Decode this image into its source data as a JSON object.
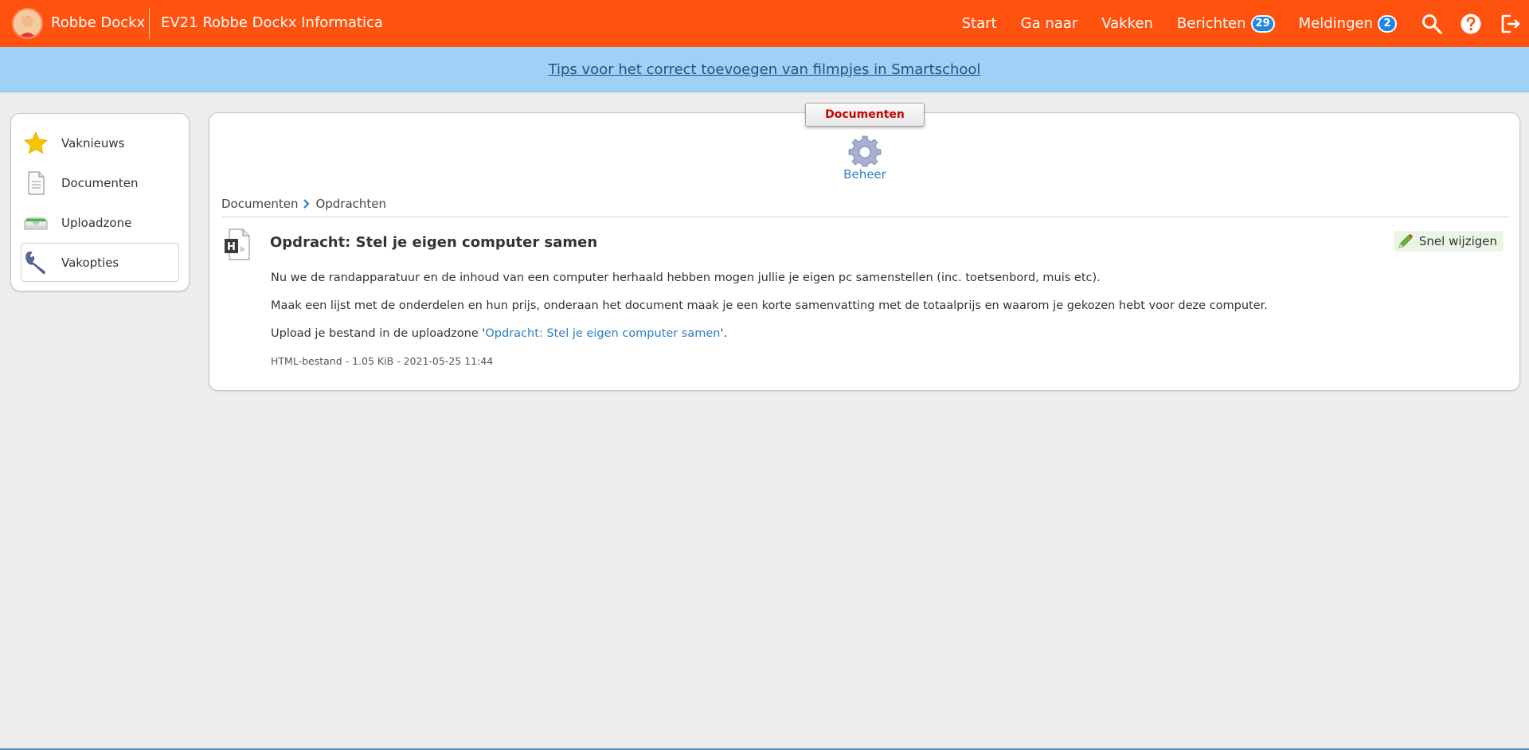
{
  "topbar": {
    "user_name": "Robbe Dockx",
    "course_title": "EV21 Robbe Dockx Informatica",
    "nav": [
      {
        "label": "Start"
      },
      {
        "label": "Ga naar"
      },
      {
        "label": "Vakken"
      },
      {
        "label": "Berichten",
        "badge": "29"
      },
      {
        "label": "Meldingen",
        "badge": "2"
      }
    ],
    "icons": [
      "search-icon",
      "help-icon",
      "logout-icon"
    ],
    "color": "#ff520e"
  },
  "banner": {
    "link_text": "Tips voor het correct toevoegen van filmpjes in Smartschool",
    "color": "#9fd0f5"
  },
  "sidebar": {
    "items": [
      {
        "label": "Vaknieuws",
        "icon": "star-icon"
      },
      {
        "label": "Documenten",
        "icon": "document-icon"
      },
      {
        "label": "Uploadzone",
        "icon": "upload-tray-icon"
      },
      {
        "label": "Vakopties",
        "icon": "wrench-icon",
        "active": true
      }
    ]
  },
  "main": {
    "section_tab": "Documenten",
    "admin_label": "Beheer",
    "breadcrumb": [
      "Documenten",
      "Opdrachten"
    ],
    "document": {
      "title": "Opdracht: Stel je eigen computer samen",
      "quick_edit_label": "Snel wijzigen",
      "line1": "Nu we de randapparatuur en de inhoud van een computer herhaald hebben mogen jullie je eigen pc samenstellen (inc. toetsenbord, muis etc).",
      "line2": "Maak een lijst met de onderdelen en hun prijs, onderaan het document maak je een korte samenvatting met de totaalprijs en waarom je gekozen hebt voor deze computer.",
      "line3_prefix": "Upload je bestand in de uploadzone '",
      "line3_link": "Opdracht: Stel je eigen computer samen",
      "line3_suffix": "'.",
      "meta": "HTML-bestand - 1.05 KiB - 2021-05-25 11:44"
    }
  }
}
